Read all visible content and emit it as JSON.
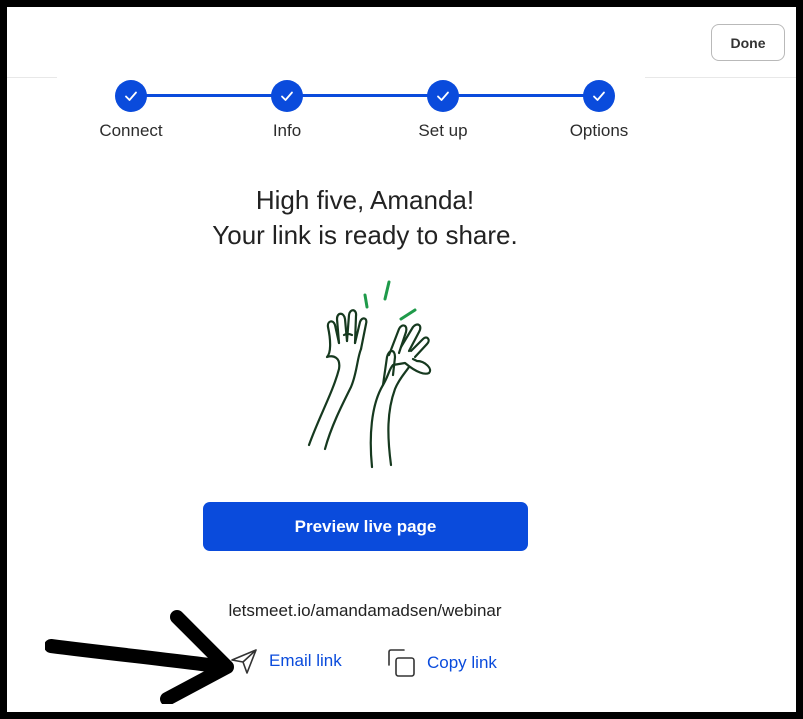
{
  "header": {
    "done_label": "Done"
  },
  "stepper": {
    "accent": "#0a4bdc",
    "steps": [
      {
        "label": "Connect",
        "completed": true
      },
      {
        "label": "Info",
        "completed": true
      },
      {
        "label": "Set up",
        "completed": true
      },
      {
        "label": "Options",
        "completed": true
      }
    ]
  },
  "main": {
    "headline_line1": "High five, Amanda!",
    "headline_line2": "Your link is ready to share.",
    "illustration": "high-five-hands-icon",
    "preview_button_label": "Preview live page",
    "share_url": "letsmeet.io/amandamadsen/webinar",
    "actions": [
      {
        "label": "Email link",
        "icon": "send-icon"
      },
      {
        "label": "Copy link",
        "icon": "copy-icon"
      }
    ]
  },
  "annotation": {
    "icon": "arrow-right-icon",
    "color": "#000000"
  }
}
